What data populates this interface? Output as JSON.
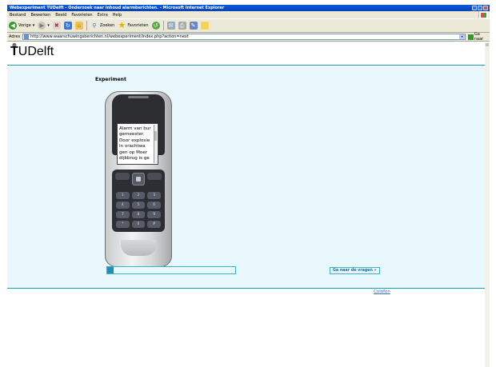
{
  "window": {
    "title": "Webexperiment TUDelft - Onderzoek naar inhoud alarmberichten. - Microsoft Internet Explorer"
  },
  "menu": [
    "Bestand",
    "Bewerken",
    "Beeld",
    "Favorieten",
    "Extra",
    "Help"
  ],
  "toolbar": {
    "back_label": "Vorige",
    "search_label": "Zoeken",
    "favorites_label": "Favorieten"
  },
  "address": {
    "label": "Adres",
    "url": "http://www.waarschuwingsberichten.nl/webexperiment/index.php?action=next",
    "go_label": "Ga naar"
  },
  "page": {
    "logo_text": "UDelft",
    "logo_initial": "T",
    "heading": "Experiment",
    "phone_message": "Alarm van bur gemeester. Door explosie in vrachtwa gen op Moer dijkbrug is ge",
    "progress": 0.05,
    "next_button": "Ga naar de vragen »",
    "footer_link": "Colofon"
  },
  "keypad": [
    "1",
    "2",
    "3",
    "4",
    "5",
    "6",
    "7",
    "8",
    "9",
    "*",
    "0",
    "#"
  ],
  "colors": {
    "accent": "#1a9eb0",
    "band": "#e8f8fc",
    "progress_fill": "#1f8fb4"
  },
  "icons": [
    "back-icon",
    "forward-icon",
    "stop-icon",
    "refresh-icon",
    "home-icon",
    "search-icon",
    "favorites-icon",
    "history-icon",
    "mail-icon",
    "print-icon",
    "edit-icon",
    "folder-icon"
  ]
}
